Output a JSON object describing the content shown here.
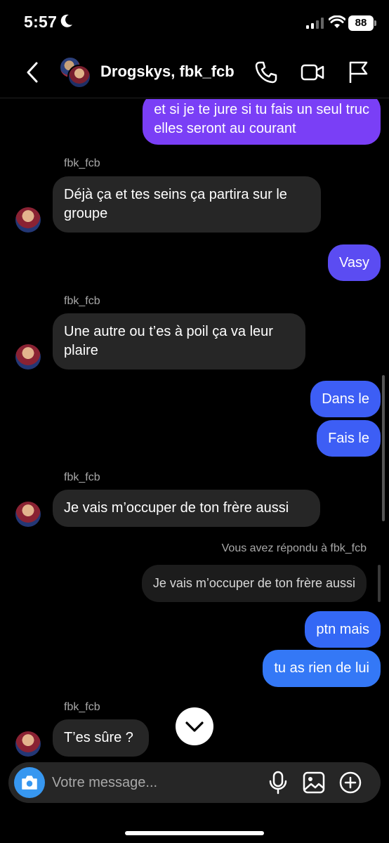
{
  "status": {
    "time": "5:57",
    "battery": "88"
  },
  "header": {
    "title": "Drogskys, fbk_fcb"
  },
  "colors": {
    "outgoing_purple": "#7a3ff6",
    "outgoing_blue": "#3d5ef5",
    "outgoing_blue2": "#3478f6",
    "incoming": "#262626",
    "accent": "#3797f0"
  },
  "messages": {
    "m1": {
      "lines": [
        "et si je te jure si tu fais un seul truc",
        "elles seront au courant"
      ]
    },
    "s1": "fbk_fcb",
    "m2": {
      "lines": [
        "Déjà ça et tes seins ça partira sur le",
        "groupe"
      ]
    },
    "m3": "Vasy",
    "s2": "fbk_fcb",
    "m4": {
      "lines": [
        "Une autre ou t’es à poil ça va leur",
        "plaire"
      ]
    },
    "m5": "Dans le",
    "m6": "Fais le",
    "s3": "fbk_fcb",
    "m7": "Je vais m’occuper de ton frère aussi",
    "reply_note": "Vous avez répondu à fbk_fcb",
    "reply_quote": "Je vais m’occuper de ton frère aussi",
    "m8": "ptn mais",
    "m9": "tu as rien de lui",
    "s4": "fbk_fcb",
    "m10": "T’es sûre ?"
  },
  "composer": {
    "placeholder": "Votre message..."
  }
}
